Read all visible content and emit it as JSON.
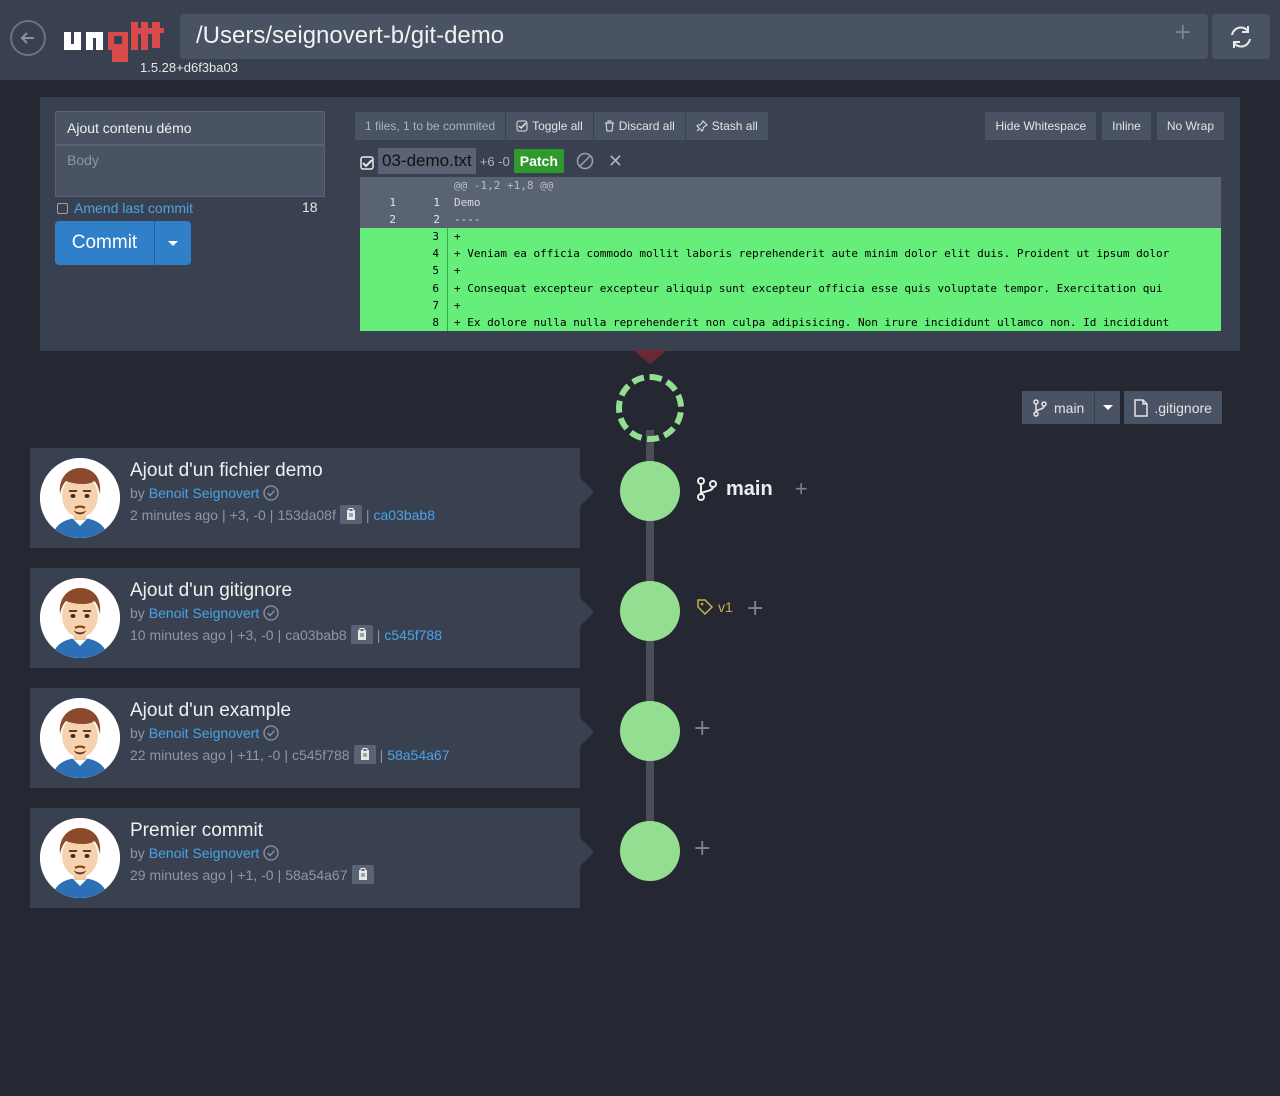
{
  "header": {
    "version": "1.5.28+d6f3ba03",
    "repo_path": "/Users/seignovert-b/git-demo",
    "logo_text": "ungit",
    "colors": {
      "logo_white": "#ffffff",
      "logo_red": "#d94a4a",
      "header_bg": "#394150"
    }
  },
  "staging": {
    "commit_title": "Ajout contenu démo",
    "body_placeholder": "Body",
    "amend_label": "Amend last commit",
    "char_count": "18",
    "commit_label": "Commit",
    "toolbar": {
      "files_info": "1 files, 1 to be commited",
      "toggle_all": "Toggle all",
      "discard_all": "Discard all",
      "stash_all": "Stash all",
      "hide_whitespace": "Hide Whitespace",
      "inline": "Inline",
      "no_wrap": "No Wrap"
    },
    "file": {
      "name": "03-demo.txt",
      "stat": "+6 -0",
      "patch_label": "Patch"
    },
    "diff": [
      {
        "type": "hunk",
        "n1": "",
        "n2": "",
        "code": "@@ -1,2 +1,8 @@"
      },
      {
        "type": "ctx",
        "n1": "1",
        "n2": "1",
        "code": " Demo"
      },
      {
        "type": "ctx",
        "n1": "2",
        "n2": "2",
        "code": " ----"
      },
      {
        "type": "add",
        "n1": "",
        "n2": "3",
        "code": "+"
      },
      {
        "type": "add",
        "n1": "",
        "n2": "4",
        "code": "+ Veniam ea officia commodo mollit laboris reprehenderit aute minim dolor elit duis. Proident ut ipsum dolor"
      },
      {
        "type": "add",
        "n1": "",
        "n2": "5",
        "code": "+"
      },
      {
        "type": "add",
        "n1": "",
        "n2": "6",
        "code": "+ Consequat excepteur excepteur aliquip sunt excepteur officia esse quis voluptate tempor. Exercitation qui"
      },
      {
        "type": "add",
        "n1": "",
        "n2": "7",
        "code": "+"
      },
      {
        "type": "add",
        "n1": "",
        "n2": "8",
        "code": "+ Ex dolore nulla nulla reprehenderit non culpa adipisicing. Non irure incididunt ullamco non. Id incididunt"
      }
    ]
  },
  "branch_controls": {
    "branch": "main",
    "file": ".gitignore"
  },
  "refs": {
    "main_label": "main",
    "tag_label": "v1"
  },
  "commits": [
    {
      "title": "Ajout d'un fichier demo",
      "by": "by",
      "author": "Benoit Seignovert",
      "time": "2 minutes ago",
      "stats": "+3, -0",
      "sha": "153da08f",
      "parent": "ca03bab8"
    },
    {
      "title": "Ajout d'un gitignore",
      "by": "by",
      "author": "Benoit Seignovert",
      "time": "10 minutes ago",
      "stats": "+3, -0",
      "sha": "ca03bab8",
      "parent": "c545f788"
    },
    {
      "title": "Ajout d'un example",
      "by": "by",
      "author": "Benoit Seignovert",
      "time": "22 minutes ago",
      "stats": "+11, -0",
      "sha": "c545f788",
      "parent": "58a54a67"
    },
    {
      "title": "Premier commit",
      "by": "by",
      "author": "Benoit Seignovert",
      "time": "29 minutes ago",
      "stats": "+1, -0",
      "sha": "58a54a67",
      "parent": ""
    }
  ],
  "colors": {
    "node": "#93de90",
    "link": "#4aa3e6",
    "commit_button": "#2f80c8",
    "patch_button": "#2e9a2e",
    "diff_added": "#66ee7a",
    "tag": "#c7b343"
  }
}
